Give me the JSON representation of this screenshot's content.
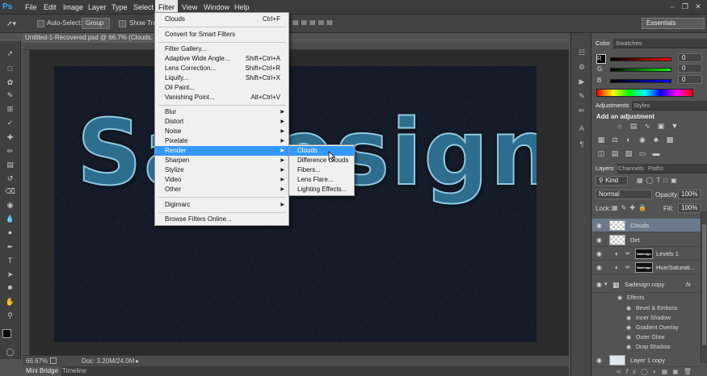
{
  "app": {
    "logo": "Ps",
    "menus": [
      "File",
      "Edit",
      "Image",
      "Layer",
      "Type",
      "Select",
      "Filter",
      "View",
      "Window",
      "Help"
    ],
    "active_menu": "Filter"
  },
  "options_bar": {
    "auto_select_label": "Auto-Select:",
    "auto_select_value": "Group",
    "show_transform_label": "Show Tran",
    "workspace": "Essentials"
  },
  "document": {
    "tab_title": "Untitled-1-Recovered.psd @ 66.7% (Clouds, RGB",
    "artwork_text": "Sadesign"
  },
  "status": {
    "zoom": "66.67%",
    "doc_size": "Doc: 3.20M/24.0M"
  },
  "bottom_tabs": [
    "Mini Bridge",
    "Timeline"
  ],
  "filter_menu": {
    "last_filter": {
      "label": "Clouds",
      "shortcut": "Ctrl+F"
    },
    "convert": "Convert for Smart Filters",
    "group1": [
      {
        "label": "Filter Gallery...",
        "shortcut": ""
      },
      {
        "label": "Adaptive Wide Angle...",
        "shortcut": "Shift+Ctrl+A"
      },
      {
        "label": "Lens Correction...",
        "shortcut": "Shift+Ctrl+R"
      },
      {
        "label": "Liquify...",
        "shortcut": "Shift+Ctrl+X"
      },
      {
        "label": "Oil Paint...",
        "shortcut": ""
      },
      {
        "label": "Vanishing Point...",
        "shortcut": "Alt+Ctrl+V"
      }
    ],
    "submenus": [
      "Blur",
      "Distort",
      "Noise",
      "Pixelate",
      "Render",
      "Sharpen",
      "Stylize",
      "Video",
      "Other"
    ],
    "highlighted": "Render",
    "digimarc": "Digimarc",
    "browse": "Browse Filters Online..."
  },
  "render_submenu": {
    "items": [
      "Clouds",
      "Difference Clouds",
      "Fibers...",
      "Lens Flare...",
      "Lighting Effects..."
    ],
    "highlighted": "Clouds"
  },
  "color_panel": {
    "tabs": [
      "Color",
      "Swatches"
    ],
    "channels": [
      {
        "label": "R",
        "value": "0"
      },
      {
        "label": "G",
        "value": "0"
      },
      {
        "label": "B",
        "value": "0"
      }
    ]
  },
  "adjustments_panel": {
    "tabs": [
      "Adjustments",
      "Styles"
    ],
    "heading": "Add an adjustment"
  },
  "layers_panel": {
    "tabs": [
      "Layers",
      "Channels",
      "Paths"
    ],
    "filter_kind": "Kind",
    "blend_mode": "Normal",
    "opacity_label": "Opacity:",
    "opacity_value": "100%",
    "lock_label": "Lock:",
    "fill_label": "Fill:",
    "fill_value": "100%",
    "layers": [
      {
        "name": "Clouds",
        "selected": true
      },
      {
        "name": "Dirt",
        "selected": false
      },
      {
        "name": "Levels 1",
        "selected": false
      },
      {
        "name": "Hue/Saturati...",
        "selected": false
      },
      {
        "name": "Sadesign copy",
        "selected": false
      }
    ],
    "mask_thumb_text": "Sadesign",
    "fx_label": "fx",
    "effects_label": "Effects",
    "effects": [
      "Bevel & Emboss",
      "Inner Shadow",
      "Gradient Overlay",
      "Outer Glow",
      "Drop Shadow"
    ],
    "bottom_layer": "Layer 1 copy"
  },
  "colors": {
    "menubar_bg": "#3c3c3c",
    "menu_highlight": "#3399ff",
    "selected_layer": "#6a7a8c",
    "artwork_denim": "#2d6e8f"
  }
}
